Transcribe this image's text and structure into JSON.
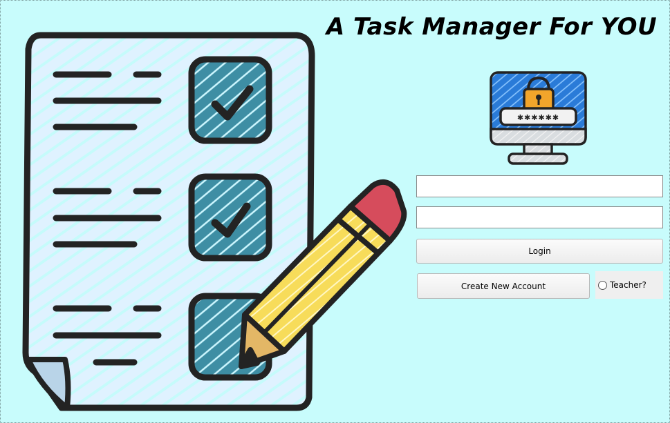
{
  "app": {
    "title": "A Task Manager For YOU"
  },
  "images": {
    "hero": "checklist-with-pencil-illustration",
    "login_icon": "computer-lock-password-icon"
  },
  "login_icon": {
    "password_mask": "✱✱✱✱✱✱"
  },
  "form": {
    "username_value": "",
    "password_value": "",
    "login_label": "Login",
    "create_account_label": "Create New Account",
    "teacher_label": "Teacher?",
    "teacher_checked": false
  },
  "colors": {
    "background": "#c8fcfc",
    "checkbox_fill": "#3e8ea4",
    "pencil_body": "#f7dc5a",
    "pencil_eraser": "#d64c5c",
    "monitor_screen": "#2a7bd8",
    "lock": "#f2a52b"
  }
}
